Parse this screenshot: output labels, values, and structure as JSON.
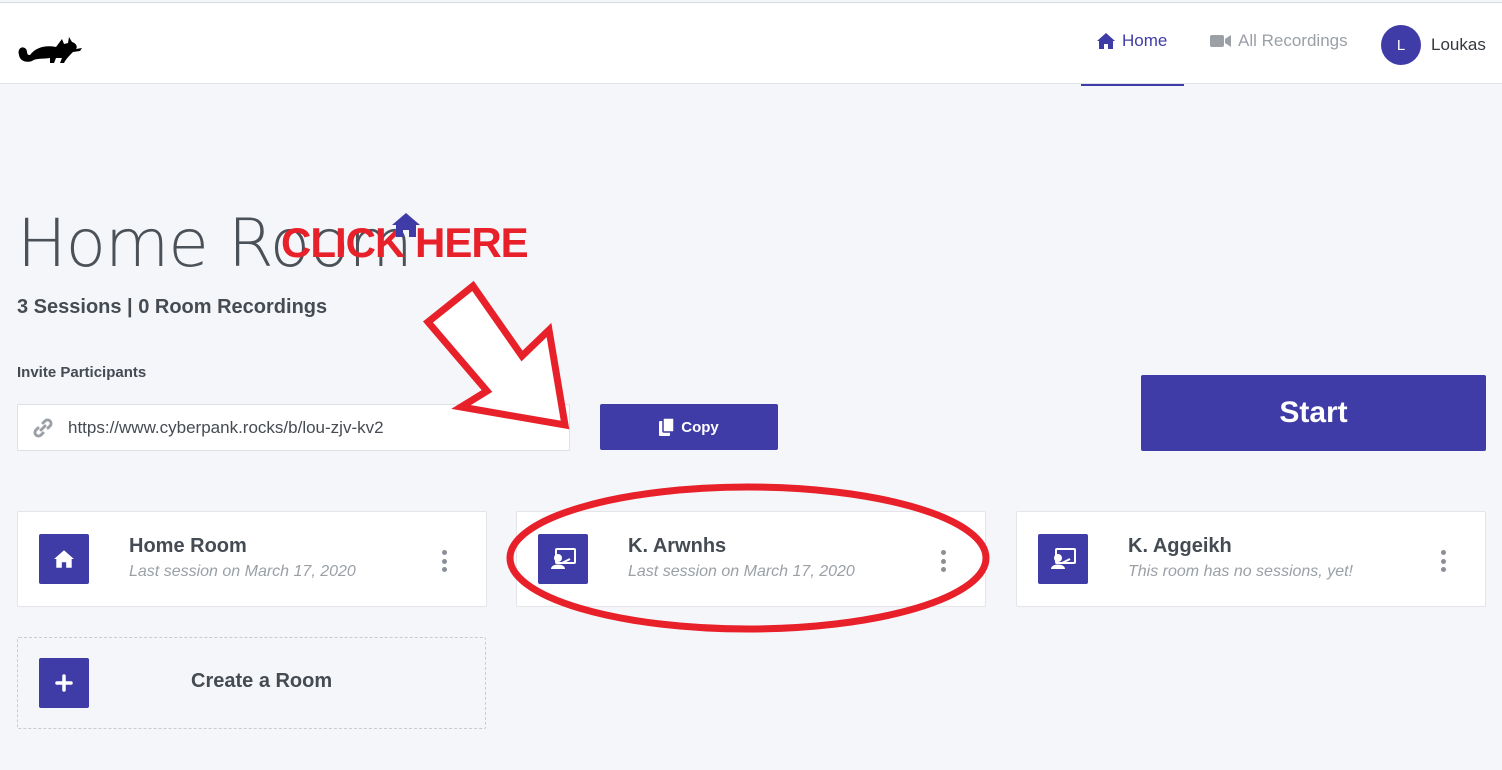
{
  "nav": {
    "home_label": "Home",
    "recordings_label": "All Recordings",
    "avatar_initial": "L",
    "username": "Loukas"
  },
  "room": {
    "title": "Home Room",
    "stats": "3 Sessions | 0 Room Recordings",
    "invite_label": "Invite Participants",
    "invite_url": "https://www.cyberpank.rocks/b/lou-zjv-kv2",
    "copy_label": "Copy",
    "start_label": "Start"
  },
  "rooms": [
    {
      "name": "Home Room",
      "subtitle": "Last session on March 17, 2020",
      "icon": "home-icon"
    },
    {
      "name": "K. Arwnhs",
      "subtitle": "Last session on March 17, 2020",
      "icon": "presenter-icon"
    },
    {
      "name": "K. Aggeikh",
      "subtitle": "This room has no sessions, yet!",
      "icon": "presenter-icon"
    }
  ],
  "create_room_label": "Create a Room",
  "annotation": {
    "text": "CLICK HERE",
    "color": "#e8202a"
  },
  "colors": {
    "accent": "#3f3ca7",
    "background": "#f5f6f9"
  }
}
